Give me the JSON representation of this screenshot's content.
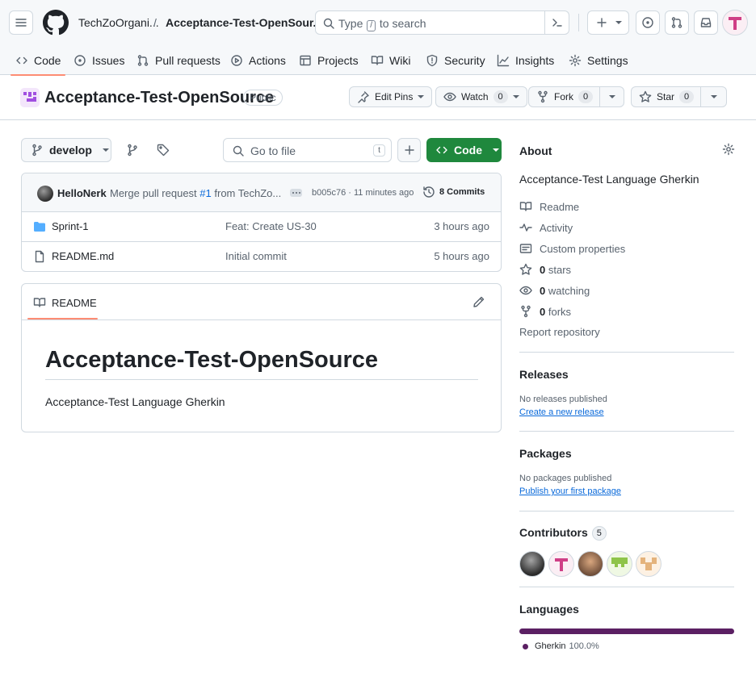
{
  "nav": {
    "org": "TechZoOrgani...",
    "separator": "/",
    "repo": "Acceptance-Test-OpenSour...",
    "search_before": "Type",
    "search_key": "/",
    "search_after": "to search"
  },
  "tabs": [
    {
      "label": "Code",
      "icon": "code-icon",
      "active": true
    },
    {
      "label": "Issues",
      "icon": "issue-opened-icon"
    },
    {
      "label": "Pull requests",
      "icon": "git-pull-request-icon"
    },
    {
      "label": "Actions",
      "icon": "play-icon"
    },
    {
      "label": "Projects",
      "icon": "table-icon"
    },
    {
      "label": "Wiki",
      "icon": "book-icon"
    },
    {
      "label": "Security",
      "icon": "shield-icon"
    },
    {
      "label": "Insights",
      "icon": "graph-icon"
    },
    {
      "label": "Settings",
      "icon": "gear-icon"
    }
  ],
  "repo": {
    "name": "Acceptance-Test-OpenSource",
    "visibility": "Public",
    "edit_pins": "Edit Pins",
    "watch": "Watch",
    "watch_count": "0",
    "fork": "Fork",
    "fork_count": "0",
    "star": "Star",
    "star_count": "0"
  },
  "toolbar": {
    "branch": "develop",
    "goto_placeholder": "Go to file",
    "goto_key": "t",
    "code_button": "Code"
  },
  "commit": {
    "author": "HelloNerk",
    "message_prefix": "Merge pull request",
    "pr_link": "#1",
    "message_suffix": "from TechZo...",
    "meta": "b005c76 · 11 minutes ago",
    "commits_label": "8 Commits"
  },
  "files": [
    {
      "name": "Sprint-1",
      "type": "folder",
      "message": "Feat: Create US-30",
      "time": "3 hours ago"
    },
    {
      "name": "README.md",
      "type": "file",
      "message": "Initial commit",
      "time": "5 hours ago"
    }
  ],
  "readme": {
    "tab": "README",
    "heading": "Acceptance-Test-OpenSource",
    "body": "Acceptance-Test Language Gherkin"
  },
  "about": {
    "title": "About",
    "description": "Acceptance-Test Language Gherkin",
    "links": {
      "readme": "Readme",
      "activity": "Activity",
      "custom_properties": "Custom properties",
      "stars_count": "0",
      "stars_label": "stars",
      "watching_count": "0",
      "watching_label": "watching",
      "forks_count": "0",
      "forks_label": "forks",
      "report": "Report repository"
    }
  },
  "releases": {
    "title": "Releases",
    "empty": "No releases published",
    "action": "Create a new release"
  },
  "packages": {
    "title": "Packages",
    "empty": "No packages published",
    "action": "Publish your first package"
  },
  "contributors": {
    "title": "Contributors",
    "count": "5"
  },
  "languages": {
    "title": "Languages",
    "items": [
      {
        "name": "Gherkin",
        "percent": "100.0%",
        "share": 1.0,
        "color": "#5b2063"
      }
    ]
  },
  "colors": {
    "accent_underline": "#fd8c73",
    "code_button": "#1f883d",
    "link": "#0969da",
    "gherkin": "#5b2063"
  }
}
